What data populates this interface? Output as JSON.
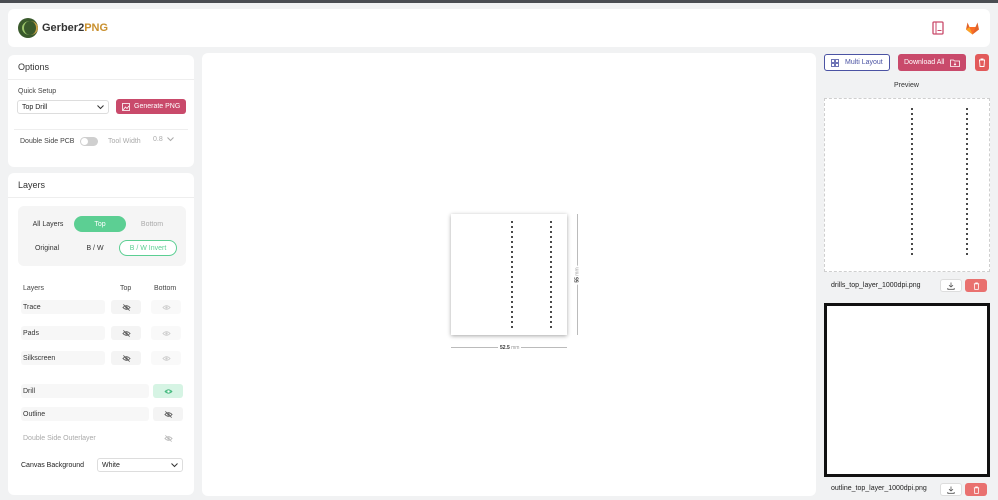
{
  "header": {
    "logo_main": "Gerber2",
    "logo_accent": "PNG",
    "icons": [
      "book-icon",
      "gitlab-icon"
    ]
  },
  "options": {
    "title": "Options",
    "quick_setup_label": "Quick Setup",
    "quick_setup_value": "Top Drill",
    "generate_label": "Generate PNG",
    "double_side_label": "Double Side PCB",
    "double_side_on": false,
    "tool_width_label": "Tool Width",
    "tool_width_value": "0.8"
  },
  "layers": {
    "title": "Layers",
    "view_modes": [
      "All Layers",
      "Top",
      "Bottom"
    ],
    "active_view": "Top",
    "color_modes": [
      "Original",
      "B / W",
      "B / W Invert"
    ],
    "active_color": "B / W Invert",
    "table_headers": {
      "name": "Layers",
      "top": "Top",
      "bottom": "Bottom"
    },
    "rows": [
      {
        "name": "Trace"
      },
      {
        "name": "Pads"
      },
      {
        "name": "Silkscreen"
      },
      {
        "name": "Drill"
      },
      {
        "name": "Outline"
      },
      {
        "name": "Double Side Outerlayer"
      }
    ],
    "canvas_bg_label": "Canvas Background",
    "canvas_bg_value": "White"
  },
  "canvas": {
    "width_value": "52.5",
    "width_unit": "mm",
    "height_value": "55",
    "height_unit": "mm"
  },
  "right": {
    "multi_layout_label": "Multi Layout",
    "download_all_label": "Download All",
    "preview_label": "Preview",
    "files": [
      {
        "name": "drills_top_layer_1000dpi.png"
      },
      {
        "name": "outline_top_layer_1000dpi.png"
      }
    ]
  },
  "colors": {
    "accent_pink": "#c94a6b",
    "accent_green": "#5ccf93",
    "accent_indigo": "#4b53a3",
    "danger_red": "#e25a5a"
  }
}
